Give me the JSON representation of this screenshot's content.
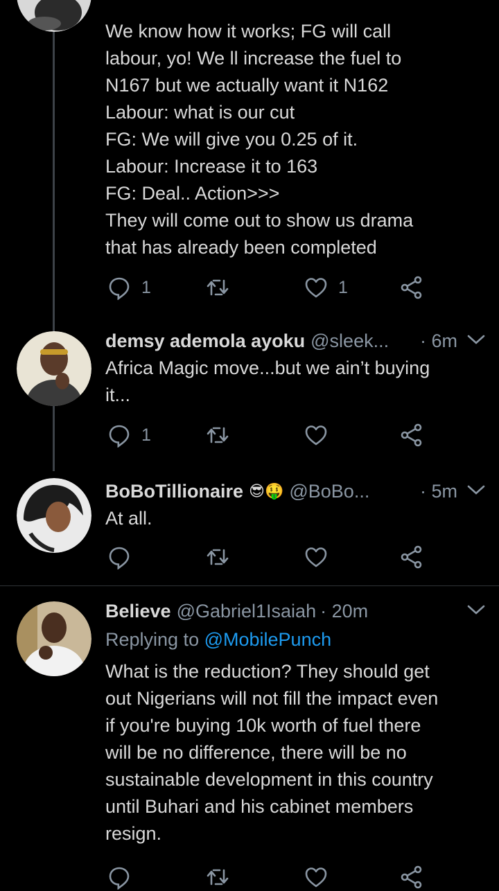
{
  "tweet1": {
    "lines": [
      "We know how it works; FG will call",
      "labour, yo! We ll increase the fuel to",
      "N167 but we actually want it N162",
      "Labour: what is our cut",
      "FG: We will give you 0.25 of it.",
      "Labour: Increase it to 163",
      "FG: Deal.. Action>>>",
      "They will come out to show us drama",
      "that has already been completed"
    ],
    "reply_count": "1",
    "like_count": "1"
  },
  "tweet2": {
    "name": "demsy ademola ayoku",
    "handle": "@sleek...",
    "time": "· 6m",
    "lines": [
      "Africa Magic move...but we ain’t buying",
      "it..."
    ],
    "reply_count": "1"
  },
  "tweet3": {
    "name": "BoBoTillionaire",
    "emoji": "😎🤑",
    "handle": "@BoBo...",
    "time": "· 5m",
    "lines": [
      "At all."
    ]
  },
  "tweet4": {
    "name": "Believe",
    "handle": "@Gabriel1Isaiah",
    "time": "· 20m",
    "replying_prefix": "Replying to ",
    "replying_mention": "@MobilePunch",
    "lines": [
      "What is the reduction? They should get",
      "out Nigerians will not fill the impact even",
      "if you're buying 10k worth of fuel there",
      "will be no difference, there will be no",
      "sustainable development in this country",
      "until Buhari and his cabinet members",
      "resign."
    ]
  },
  "colors": {
    "background": "#000000",
    "text": "#d9d9d9",
    "muted": "#8a96a3",
    "link": "#1d9bf0"
  },
  "icons": [
    "reply-icon",
    "retweet-icon",
    "like-icon",
    "share-icon",
    "chevron-down-icon"
  ]
}
